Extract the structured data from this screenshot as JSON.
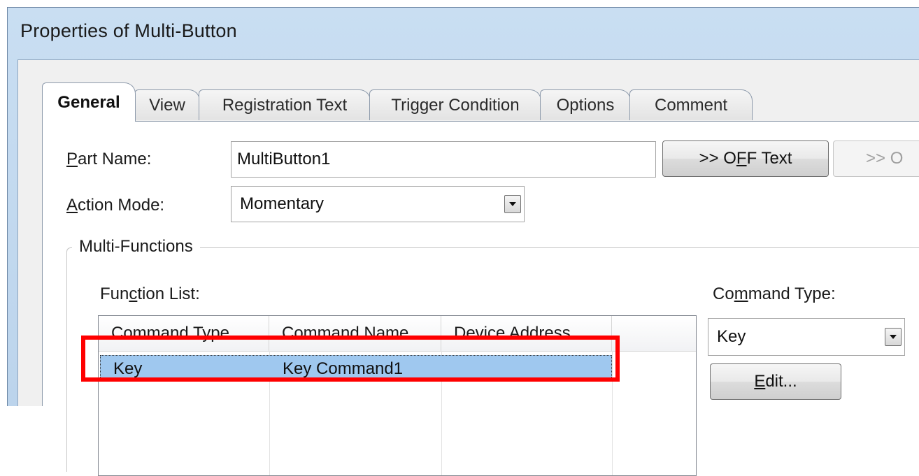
{
  "window": {
    "title": "Properties of Multi-Button"
  },
  "tabs": [
    {
      "label": "General",
      "active": true
    },
    {
      "label": "View"
    },
    {
      "label": "Registration Text"
    },
    {
      "label": "Trigger Condition"
    },
    {
      "label": "Options"
    },
    {
      "label": "Comment"
    }
  ],
  "general": {
    "part_name_label_mnemonic": "P",
    "part_name_label_rest": "art Name:",
    "part_name_value": "MultiButton1",
    "off_text_button_pre": ">> O",
    "off_text_button_mnemonic": "F",
    "off_text_button_post": "F Text",
    "on_text_button_partial": ">> O",
    "action_mode_label_mnemonic": "A",
    "action_mode_label_rest": "ction Mode:",
    "action_mode_value": "Momentary"
  },
  "multi_functions": {
    "group_title": "Multi-Functions",
    "function_list_label_pre": "Fun",
    "function_list_label_mnemonic": "c",
    "function_list_label_post": "tion List:",
    "columns": [
      "Command Type",
      "Command Name",
      "Device Address"
    ],
    "rows": [
      {
        "command_type": "Key",
        "command_name": "Key Command1",
        "device_address": ""
      }
    ],
    "command_type_label_pre": "Co",
    "command_type_label_mnemonic": "m",
    "command_type_label_post": "mand Type:",
    "command_type_value": "Key",
    "edit_button_mnemonic": "E",
    "edit_button_rest": "dit..."
  },
  "colors": {
    "highlight_box": "#ff0000",
    "selected_row": "#9fc8ef"
  }
}
